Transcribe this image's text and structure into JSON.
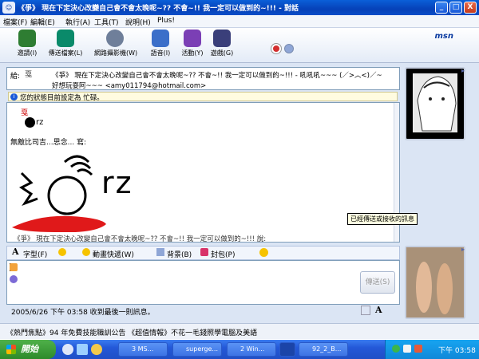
{
  "window": {
    "title": "《爭》 現在下定決心改變自己會不會太晚呢~?? 不會~!! 我一定可以做到的~!!! - 對話",
    "controls": {
      "minimize": "_",
      "maximize": "□",
      "close": "X"
    }
  },
  "menu": [
    "檔案(F)",
    "編輯(E)",
    "執行(A)",
    "工具(T)",
    "說明(H)",
    "Plus!"
  ],
  "toolbar": {
    "buttons": [
      {
        "label": "邀請(I)",
        "icon": "invite-icon",
        "color": "#2e7d32"
      },
      {
        "label": "傳送檔案(L)",
        "icon": "send-file-icon",
        "color": "#0a8a6a"
      },
      {
        "label": "網路攝影機(W)",
        "icon": "webcam-icon",
        "color": "#6f7f9a"
      },
      {
        "label": "語音(I)",
        "icon": "voice-icon",
        "color": "#3b6fc9"
      },
      {
        "label": "活動(Y)",
        "icon": "activities-icon",
        "color": "#7b3fb5"
      },
      {
        "label": "遊戲(G)",
        "icon": "games-icon",
        "color": "#3a3f7a"
      }
    ],
    "block_icon": "block-icon",
    "theme_icon": "background-icon",
    "logo": "msn"
  },
  "to": {
    "label": "給:",
    "contact_name": "《爭》 現在下定決心改變自己會不會太晚呢~?? 不會~!! 我一定可以做到的~!!! - 吼吼吼~~~ (／>︿<)／~",
    "contact_sub": "好想玩耍阿~~~ <amy011794@hotmail.com>"
  },
  "status_notice": "您的狀態目前設定為 忙碌。",
  "history": {
    "emoticon_text": "rz",
    "message_text": "無敵比司吉...思念... 寫:",
    "big_drawing_text": "rz",
    "cut_line": "《爭》 現在下定決心改變自己會不會太晚呢~?? 不會~!! 我一定可以做到的~!!! 說:"
  },
  "tooltip": "已經傳送或接收的訊息",
  "input_toolbar": [
    {
      "label": "字型(F)",
      "icon": "font-icon"
    },
    {
      "label": "",
      "icon": "emoticon-icon"
    },
    {
      "label": "動畫快遞(W)",
      "icon": "wink-icon"
    },
    {
      "label": "背景(B)",
      "icon": "background-icon"
    },
    {
      "label": "封包(P)",
      "icon": "gift-icon"
    },
    {
      "label": "",
      "icon": "nudge-icon"
    }
  ],
  "send_button": "傳送(S)",
  "last_message": "2005/6/26 下午 03:58 收到最後一則訊息。",
  "ad_bar": "《熱門焦點》94 年免費技能職訓公告 《超值情報》不花一毛錢照學電腦及美語",
  "taskbar": {
    "start": "開始",
    "buttons": [
      "3 MS...",
      "superge...",
      "2 Win...",
      "",
      "92_2_B..."
    ],
    "clock": "下午 03:58"
  }
}
